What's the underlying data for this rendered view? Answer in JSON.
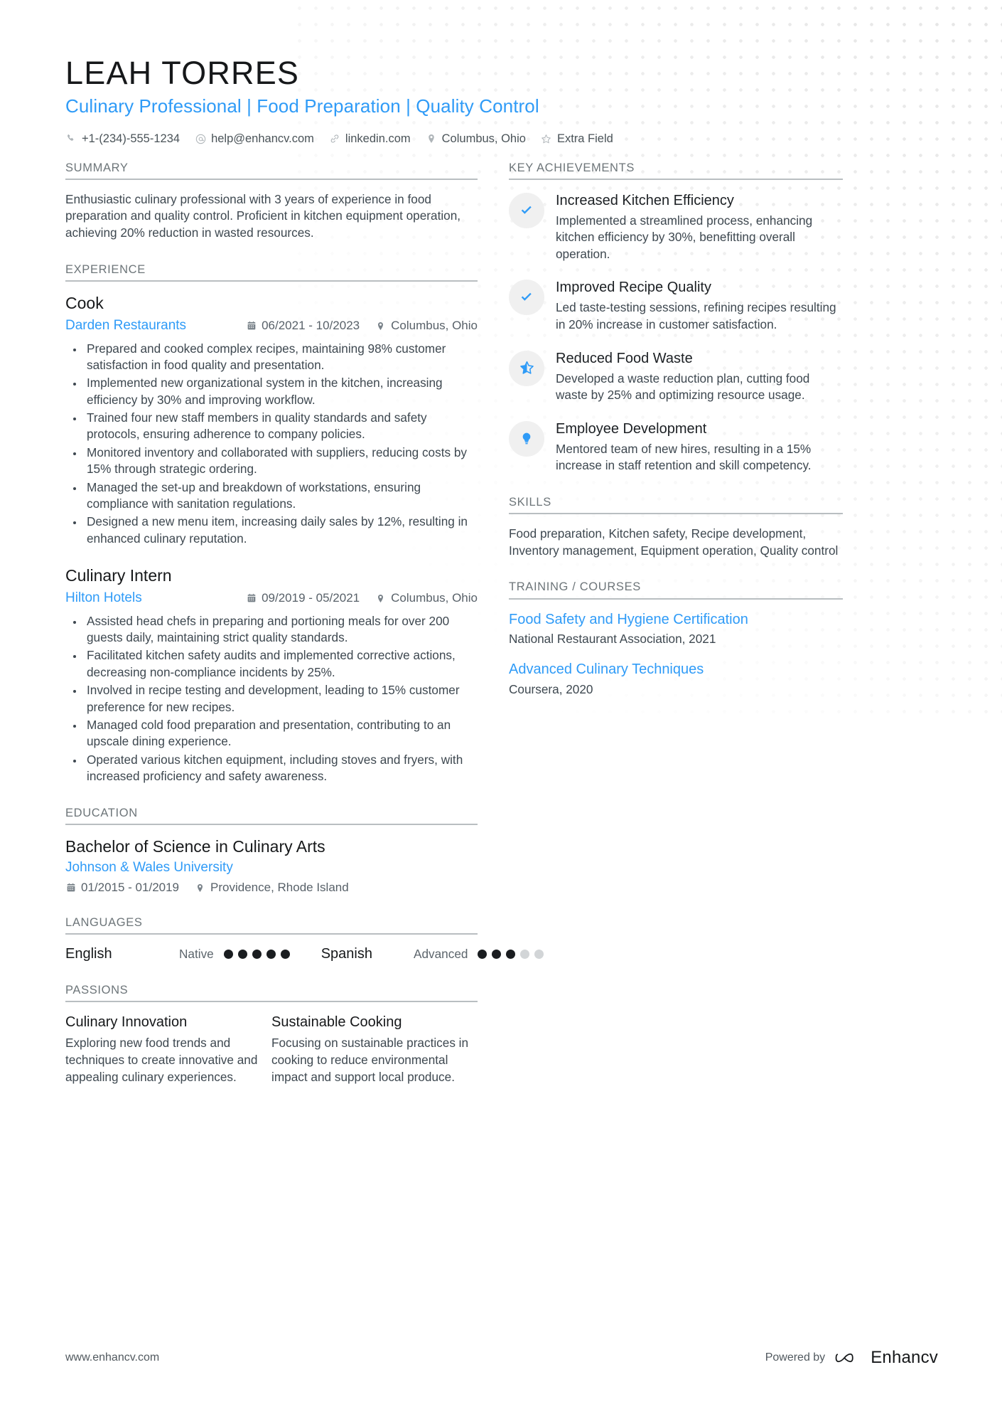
{
  "header": {
    "name": "LEAH TORRES",
    "headline": "Culinary Professional | Food Preparation | Quality Control",
    "contacts": [
      {
        "icon": "phone-icon",
        "text": "+1-(234)-555-1234"
      },
      {
        "icon": "email-icon",
        "text": "help@enhancv.com"
      },
      {
        "icon": "link-icon",
        "text": "linkedin.com"
      },
      {
        "icon": "location-pin-icon",
        "text": "Columbus, Ohio"
      },
      {
        "icon": "star-outline-icon",
        "text": "Extra Field"
      }
    ]
  },
  "summary": {
    "title": "SUMMARY",
    "text": "Enthusiastic culinary professional with 3 years of experience in food preparation and quality control. Proficient in kitchen equipment operation, achieving 20% reduction in wasted resources."
  },
  "experience": {
    "title": "EXPERIENCE",
    "jobs": [
      {
        "role": "Cook",
        "company": "Darden Restaurants",
        "dates": "06/2021 - 10/2023",
        "location": "Columbus, Ohio",
        "bullets": [
          "Prepared and cooked complex recipes, maintaining 98% customer satisfaction in food quality and presentation.",
          "Implemented new organizational system in the kitchen, increasing efficiency by 30% and improving workflow.",
          "Trained four new staff members in quality standards and safety protocols, ensuring adherence to company policies.",
          "Monitored inventory and collaborated with suppliers, reducing costs by 15% through strategic ordering.",
          "Managed the set-up and breakdown of workstations, ensuring compliance with sanitation regulations.",
          "Designed a new menu item, increasing daily sales by 12%, resulting in enhanced culinary reputation."
        ]
      },
      {
        "role": "Culinary Intern",
        "company": "Hilton Hotels",
        "dates": "09/2019 - 05/2021",
        "location": "Columbus, Ohio",
        "bullets": [
          "Assisted head chefs in preparing and portioning meals for over 200 guests daily, maintaining strict quality standards.",
          "Facilitated kitchen safety audits and implemented corrective actions, decreasing non-compliance incidents by 25%.",
          "Involved in recipe testing and development, leading to 15% customer preference for new recipes.",
          "Managed cold food preparation and presentation, contributing to an upscale dining experience.",
          "Operated various kitchen equipment, including stoves and fryers, with increased proficiency and safety awareness."
        ]
      }
    ]
  },
  "education": {
    "title": "EDUCATION",
    "items": [
      {
        "degree": "Bachelor of Science in Culinary Arts",
        "school": "Johnson & Wales University",
        "dates": "01/2015 - 01/2019",
        "location": "Providence, Rhode Island"
      }
    ]
  },
  "languages": {
    "title": "LANGUAGES",
    "items": [
      {
        "name": "English",
        "level": "Native",
        "filled": 5,
        "total": 5
      },
      {
        "name": "Spanish",
        "level": "Advanced",
        "filled": 3,
        "total": 5
      }
    ]
  },
  "passions": {
    "title": "PASSIONS",
    "items": [
      {
        "name": "Culinary Innovation",
        "desc": "Exploring new food trends and techniques to create innovative and appealing culinary experiences."
      },
      {
        "name": "Sustainable Cooking",
        "desc": "Focusing on sustainable practices in cooking to reduce environmental impact and support local produce."
      }
    ]
  },
  "achievements": {
    "title": "KEY ACHIEVEMENTS",
    "items": [
      {
        "icon": "check-icon",
        "title": "Increased Kitchen Efficiency",
        "desc": "Implemented a streamlined process, enhancing kitchen efficiency by 30%, benefitting overall operation."
      },
      {
        "icon": "check-icon",
        "title": "Improved Recipe Quality",
        "desc": "Led taste-testing sessions, refining recipes resulting in 20% increase in customer satisfaction."
      },
      {
        "icon": "star-half-icon",
        "title": "Reduced Food Waste",
        "desc": "Developed a waste reduction plan, cutting food waste by 25% and optimizing resource usage."
      },
      {
        "icon": "lightbulb-icon",
        "title": "Employee Development",
        "desc": "Mentored team of new hires, resulting in a 15% increase in staff retention and skill competency."
      }
    ]
  },
  "skills": {
    "title": "SKILLS",
    "text": "Food preparation, Kitchen safety, Recipe development, Inventory management, Equipment operation, Quality control"
  },
  "training": {
    "title": "TRAINING / COURSES",
    "items": [
      {
        "name": "Food Safety and Hygiene Certification",
        "provider": "National Restaurant Association, 2021"
      },
      {
        "name": "Advanced Culinary Techniques",
        "provider": "Coursera, 2020"
      }
    ]
  },
  "footer": {
    "url": "www.enhancv.com",
    "powered_by": "Powered by",
    "brand": "Enhancv"
  },
  "colors": {
    "accent": "#2f9bf7",
    "heading": "#6d7579",
    "text": "#3e4850",
    "title": "#16181a",
    "rule": "#b9bec1",
    "badge_bg": "#f0f0f0"
  }
}
